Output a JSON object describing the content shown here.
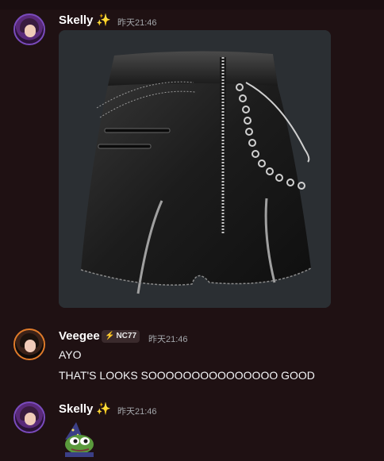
{
  "messages": [
    {
      "author": "Skelly",
      "sparkle_glyph": "✨",
      "timestamp": "昨天21:46",
      "attachment": {
        "type": "image",
        "subject": "black leather shorts 3D render"
      }
    },
    {
      "author": "Veegee",
      "badge": {
        "bolt_glyph": "⚡",
        "text": "NC77"
      },
      "timestamp": "昨天21:46",
      "lines": [
        "AYO",
        "THAT'S LOOKS SOOOOOOOOOOOOOOO GOOD"
      ]
    },
    {
      "author": "Skelly",
      "sparkle_glyph": "✨",
      "timestamp": "昨天21:46",
      "emoji": "pepe-wizard"
    }
  ],
  "colors": {
    "background": "#1f1113",
    "username": "#ffffff",
    "timestamp": "#a3a6aa",
    "skelly_ring": "#7a4bbd",
    "veegee_ring": "#e07b2a"
  }
}
